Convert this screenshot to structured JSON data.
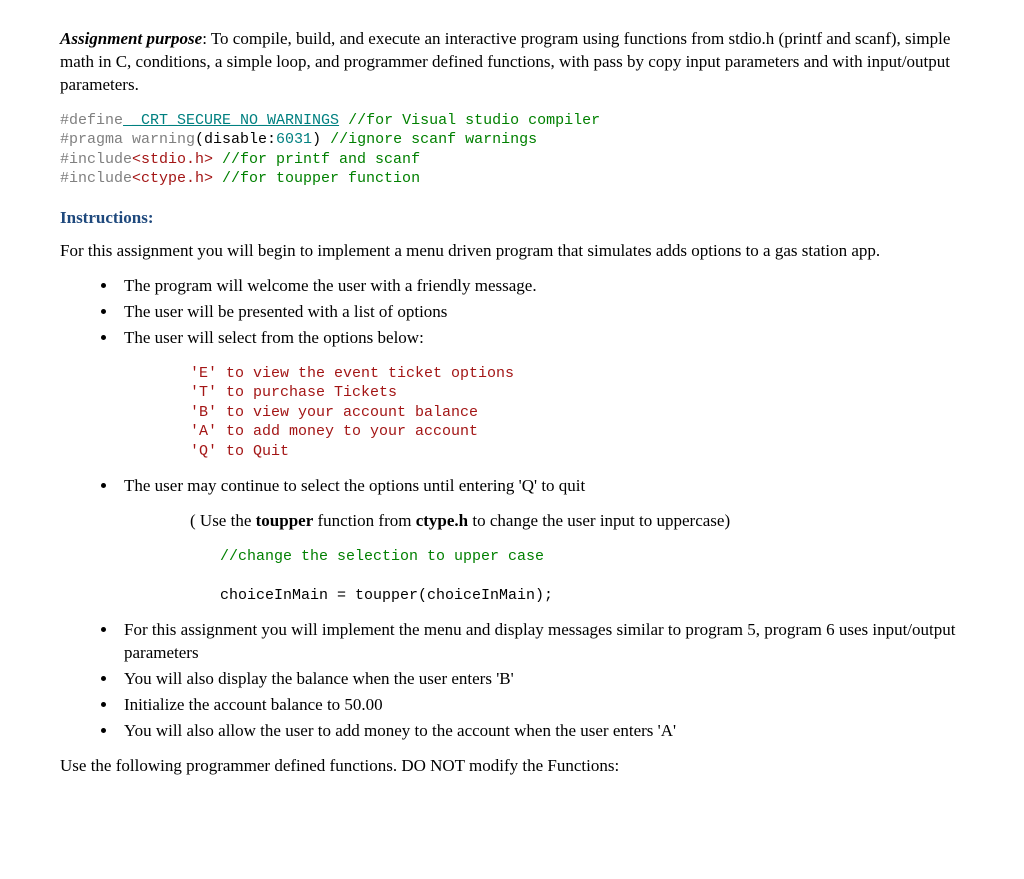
{
  "purpose": {
    "label": "Assignment purpose",
    "text": ": To compile, build, and execute an interactive program using functions from stdio.h (printf and scanf), simple math in C, conditions, a simple loop, and programmer defined functions, with pass by copy input parameters and with input/output parameters."
  },
  "codeTop": {
    "define": "#define",
    "crt": " _CRT_SECURE_NO_WARNINGS",
    "crtComment": " //for Visual studio compiler",
    "pragma": "#pragma warning",
    "pragmaArgs": "(disable:",
    "pragmaNum": "6031",
    "pragmaClose": ")",
    "pragmaComment": " //ignore scanf warnings",
    "include1": "#include",
    "stdio": "<stdio.h>",
    "stdioComment": " //for printf and scanf",
    "include2": "#include",
    "ctype": "<ctype.h>",
    "ctypeComment": " //for toupper function"
  },
  "instructionsHeading": "Instructions:",
  "intro": "For this assignment you will begin to implement a menu driven program that simulates adds options to a gas station app.",
  "bulletsTop": {
    "b1": "The program will welcome the user with a friendly message.",
    "b2": "The user will be presented with a list of options",
    "b3": "The user will select from the options below:"
  },
  "menuCode": {
    "l1": "'E' to view the event ticket options",
    "l2": "'T' to purchase Tickets",
    "l3": "'B' to view your account balance",
    "l4": "'A' to add money to your account",
    "l5": "'Q' to Quit"
  },
  "bulletContinue": "The user may continue to select the options until entering 'Q' to quit",
  "toupperNote": {
    "prefix": "( Use the ",
    "toupper": "toupper",
    "mid": " function from ",
    "ctype": "ctype.h",
    "suffix": " to change the user input to uppercase)"
  },
  "toupperCode": {
    "comment": "//change the selection to upper case",
    "line": "choiceInMain = toupper(choiceInMain);"
  },
  "bulletsBottom": {
    "b1": "For this assignment you will implement the menu and display messages similar to program 5, program 6 uses input/output parameters",
    "b2": "You will also display the balance when the user enters 'B'",
    "b3": "Initialize the account balance to 50.00",
    "b4": "You will also allow the user to add money to the account when the user enters 'A'"
  },
  "footer": "Use the following programmer defined functions. DO NOT modify the Functions:"
}
